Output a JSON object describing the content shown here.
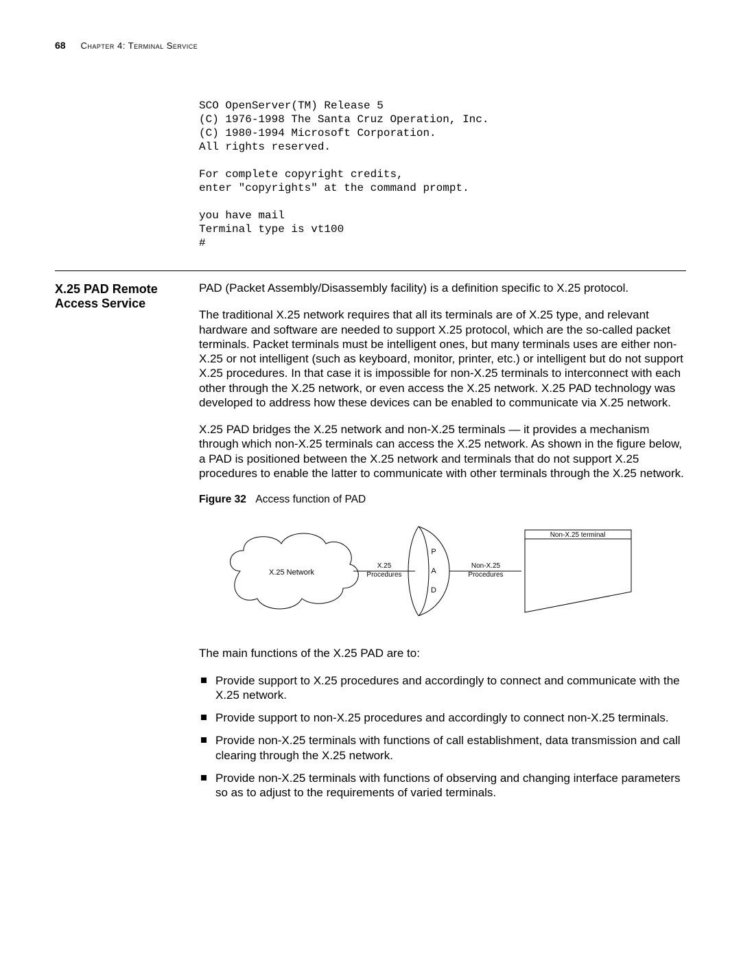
{
  "header": {
    "page_number": "68",
    "chapter_label": "Chapter 4: Terminal Service"
  },
  "terminal_output": "SCO OpenServer(TM) Release 5\n(C) 1976-1998 The Santa Cruz Operation, Inc.\n(C) 1980-1994 Microsoft Corporation.\nAll rights reserved.\n\nFor complete copyright credits,\nenter \"copyrights\" at the command prompt.\n\nyou have mail\nTerminal type is vt100\n#",
  "section": {
    "sidebar_title": "X.25 PAD Remote Access Service",
    "intro": "PAD (Packet Assembly/Disassembly facility) is a definition specific to X.25 protocol.",
    "para2": "The traditional X.25 network requires that all its terminals are of X.25 type, and relevant hardware and software are needed to support X.25 protocol, which are the so-called packet terminals. Packet terminals must be intelligent ones, but many terminals uses are either non-X.25 or not intelligent (such as keyboard, monitor, printer, etc.) or intelligent but do not support X.25 procedures. In that case it is impossible for non-X.25 terminals to interconnect with each other through the X.25 network, or even access the X.25 network. X.25 PAD technology was developed to address how these devices can be enabled to communicate via X.25 network.",
    "para3": "X.25 PAD bridges the X.25 network and non-X.25 terminals — it provides a mechanism through which non-X.25 terminals can access the X.25 network. As shown in the figure below, a PAD is positioned between the X.25 network and terminals that do not support X.25 procedures to enable the latter to communicate with other terminals through the X.25 network.",
    "figure_label": "Figure 32",
    "figure_caption": "Access function of PAD",
    "figure": {
      "cloud_label": "X.25 Network",
      "left_link": "X.25\nProcedures",
      "right_link": "Non-X.25\nProcedures",
      "pad_label": "P\nA\nD",
      "terminal_label": "Non-X.25 terminal"
    },
    "lead": "The main functions of the X.25 PAD are to:",
    "bullets": [
      "Provide support to X.25 procedures and accordingly to connect and communicate with the X.25 network.",
      "Provide support to non-X.25 procedures and accordingly to connect non-X.25 terminals.",
      "Provide non-X.25 terminals with functions of call establishment, data transmission and call clearing through the X.25 network.",
      "Provide non-X.25 terminals with functions of observing and changing interface parameters so as to adjust to the requirements of varied terminals."
    ]
  }
}
